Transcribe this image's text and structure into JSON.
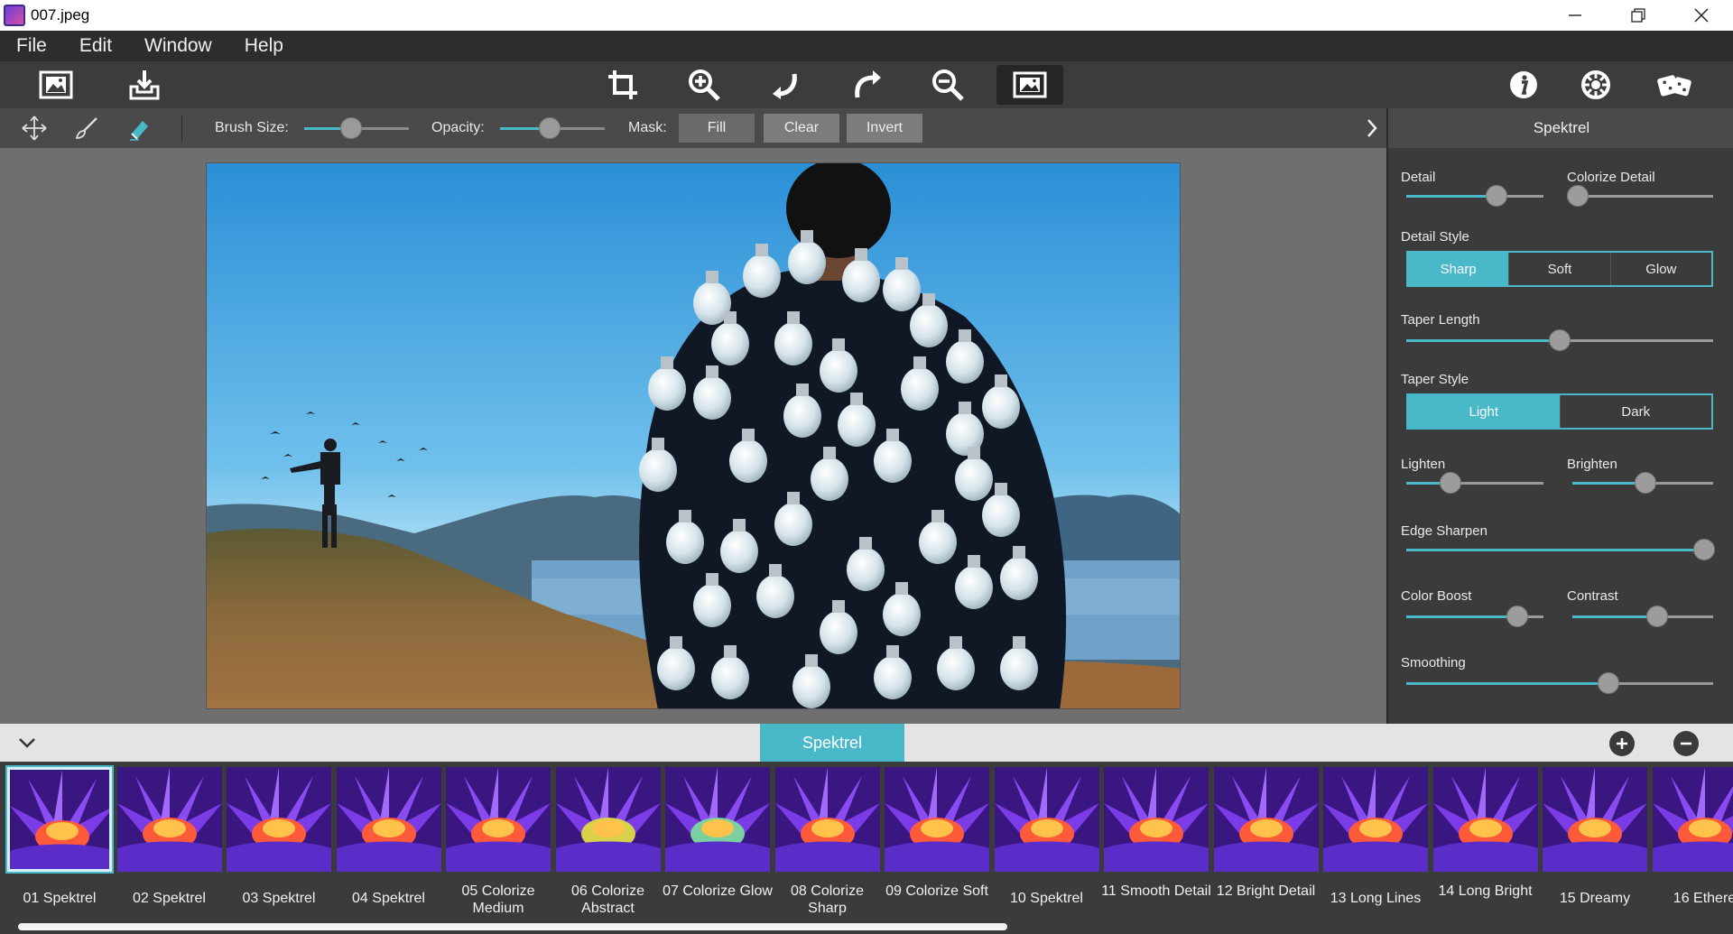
{
  "window": {
    "title": "007.jpeg",
    "minimize_icon": "minimize-icon",
    "restore_icon": "restore-icon",
    "close_icon": "close-icon"
  },
  "menu": [
    "File",
    "Edit",
    "Window",
    "Help"
  ],
  "toolbar": {
    "left": [
      "open-image-icon",
      "save-icon"
    ],
    "center": [
      "crop-icon",
      "zoom-in-icon",
      "rotate-left-icon",
      "rotate-right-icon",
      "zoom-out-icon",
      "fit-screen-icon"
    ],
    "right": [
      "info-icon",
      "settings-icon",
      "randomize-icon"
    ]
  },
  "subtoolbar": {
    "brush_size_label": "Brush Size:",
    "brush_size_value": 0.45,
    "opacity_label": "Opacity:",
    "opacity_value": 0.47,
    "mask_label": "Mask:",
    "fill_label": "Fill",
    "clear_label": "Clear",
    "invert_label": "Invert"
  },
  "panel": {
    "title": "Spektrel",
    "detail_label": "Detail",
    "detail_value": 0.66,
    "colorize_detail_label": "Colorize Detail",
    "colorize_detail_value": 0.04,
    "detail_style_label": "Detail Style",
    "detail_style_options": [
      "Sharp",
      "Soft",
      "Glow"
    ],
    "detail_style_selected": "Sharp",
    "taper_length_label": "Taper Length",
    "taper_length_value": 0.5,
    "taper_style_label": "Taper Style",
    "taper_style_options": [
      "Light",
      "Dark"
    ],
    "taper_style_selected": "Light",
    "lighten_label": "Lighten",
    "lighten_value": 0.32,
    "brighten_label": "Brighten",
    "brighten_value": 0.52,
    "edge_sharpen_label": "Edge Sharpen",
    "edge_sharpen_value": 0.97,
    "color_boost_label": "Color Boost",
    "color_boost_value": 0.81,
    "contrast_label": "Contrast",
    "contrast_value": 0.6,
    "smoothing_label": "Smoothing",
    "smoothing_value": 0.66
  },
  "strip": {
    "tab_label": "Spektrel",
    "collapse_icon": "chevron-down-icon",
    "add_icon": "plus-icon",
    "remove_icon": "minus-icon"
  },
  "presets": [
    "01 Spektrel",
    "02 Spektrel",
    "03 Spektrel",
    "04 Spektrel",
    "05 Colorize Medium",
    "06 Colorize Abstract",
    "07 Colorize Glow",
    "08 Colorize Sharp",
    "09 Colorize Soft",
    "10 Spektrel",
    "11 Smooth Detail",
    "12 Bright Detail",
    "13 Long Lines",
    "14 Long Bright",
    "15 Dreamy",
    "16 Ethere"
  ],
  "colors": {
    "accent": "#49b8c8",
    "panel": "#3b3b3b",
    "toolbar": "#3c3c3c",
    "canvas": "#6f6f6f"
  }
}
